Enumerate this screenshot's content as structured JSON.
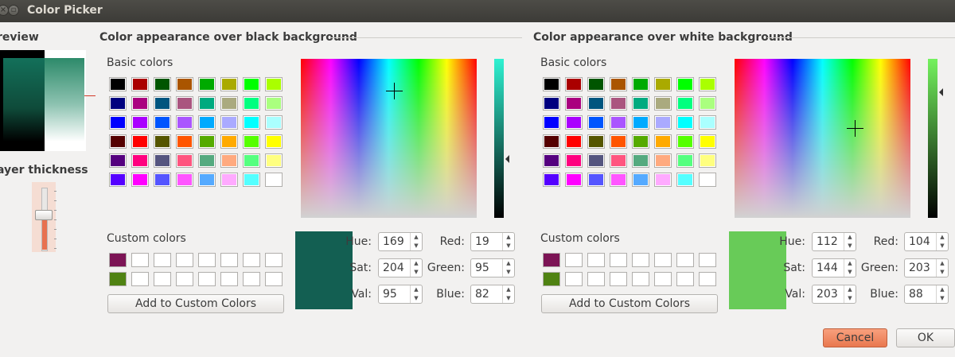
{
  "window": {
    "title": "Color Picker"
  },
  "left_panel": {
    "preview_label": "review",
    "thickness_label": "ayer thickness"
  },
  "black_panel": {
    "header": "Color appearance over black background",
    "basic_label": "Basic colors",
    "custom_label": "Custom colors",
    "add_button": "Add to Custom Colors",
    "custom_colors": [
      "#7c1455",
      "#4f8212"
    ],
    "preview_color": "#135f52",
    "value_bar_top": "#2ff2d2",
    "fields": {
      "hue_label": "Hue:",
      "hue": "169",
      "sat_label": "Sat:",
      "sat": "204",
      "val_label": "Val:",
      "val": "95",
      "red_label": "Red:",
      "red": "19",
      "green_label": "Green:",
      "green": "95",
      "blue_label": "Blue:",
      "blue": "82"
    }
  },
  "white_panel": {
    "header": "Color appearance over white background",
    "basic_label": "Basic colors",
    "custom_label": "Custom colors",
    "add_button": "Add to Custom Colors",
    "custom_colors": [
      "#7c1455",
      "#4f8212"
    ],
    "preview_color": "#68cb58",
    "value_bar_top": "#74f25e",
    "fields": {
      "hue_label": "Hue:",
      "hue": "112",
      "sat_label": "Sat:",
      "sat": "144",
      "val_label": "Val:",
      "val": "203",
      "red_label": "Red:",
      "red": "104",
      "green_label": "Green:",
      "green": "203",
      "blue_label": "Blue:",
      "blue": "88"
    }
  },
  "basic_colors": [
    [
      "#000000",
      "#aa0000",
      "#005500",
      "#aa5500",
      "#00aa00",
      "#aaaa00",
      "#00ff00",
      "#aaff00"
    ],
    [
      "#00007f",
      "#aa007f",
      "#00557f",
      "#aa557f",
      "#00aa7f",
      "#aaaa7f",
      "#00ff7f",
      "#aaff7f"
    ],
    [
      "#0000ff",
      "#aa00ff",
      "#0055ff",
      "#aa55ff",
      "#00aaff",
      "#aaaaff",
      "#00ffff",
      "#aaffff"
    ],
    [
      "#550000",
      "#ff0000",
      "#555500",
      "#ff5500",
      "#55aa00",
      "#ffaa00",
      "#55ff00",
      "#ffff00"
    ],
    [
      "#55007f",
      "#ff007f",
      "#55557f",
      "#ff557f",
      "#55aa7f",
      "#ffaa7f",
      "#55ff7f",
      "#ffff7f"
    ],
    [
      "#5500ff",
      "#ff00ff",
      "#5555ff",
      "#ff55ff",
      "#55aaff",
      "#ffaaff",
      "#55ffff",
      "#ffffff"
    ]
  ],
  "buttons": {
    "cancel": "Cancel",
    "ok": "OK"
  }
}
